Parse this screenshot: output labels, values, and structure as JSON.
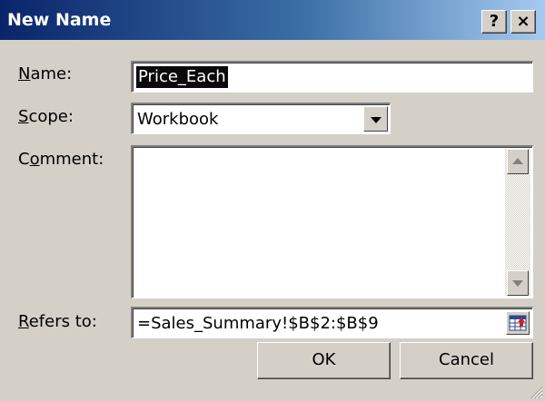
{
  "window": {
    "title": "New Name",
    "help_label": "?",
    "close_label": "×"
  },
  "fields": {
    "name_label": "Name:",
    "name_value": "Price_Each",
    "scope_label": "Scope:",
    "scope_value": "Workbook",
    "comment_label": "Comment:",
    "comment_value": "",
    "refers_label": "Refers to:",
    "refers_value": "=Sales_Summary!$B$2:$B$9"
  },
  "buttons": {
    "ok_label": "OK",
    "cancel_label": "Cancel"
  },
  "colors": {
    "title_start": "#0a246a",
    "title_end": "#a6caf0",
    "face": "#d4d0c8"
  },
  "icons": {
    "help": "question-icon",
    "close": "close-icon",
    "dropdown": "chevron-down-icon",
    "scroll_up": "arrow-up-icon",
    "scroll_down": "arrow-down-icon",
    "collapse": "collapse-dialog-icon",
    "grip": "resize-grip-icon"
  }
}
